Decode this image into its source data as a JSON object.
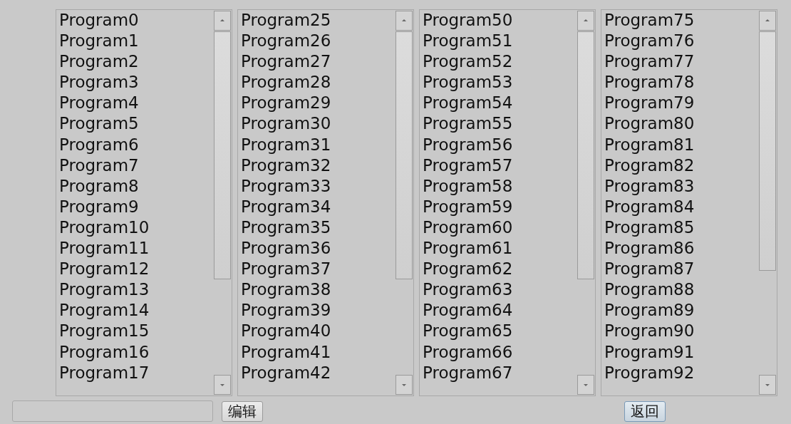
{
  "lists": [
    {
      "items": [
        "Program0",
        "Program1",
        "Program2",
        "Program3",
        "Program4",
        "Program5",
        "Program6",
        "Program7",
        "Program8",
        "Program9",
        "Program10",
        "Program11",
        "Program12",
        "Program13",
        "Program14",
        "Program15",
        "Program16",
        "Program17"
      ]
    },
    {
      "items": [
        "Program25",
        "Program26",
        "Program27",
        "Program28",
        "Program29",
        "Program30",
        "Program31",
        "Program32",
        "Program33",
        "Program34",
        "Program35",
        "Program36",
        "Program37",
        "Program38",
        "Program39",
        "Program40",
        "Program41",
        "Program42"
      ]
    },
    {
      "items": [
        "Program50",
        "Program51",
        "Program52",
        "Program53",
        "Program54",
        "Program55",
        "Program56",
        "Program57",
        "Program58",
        "Program59",
        "Program60",
        "Program61",
        "Program62",
        "Program63",
        "Program64",
        "Program65",
        "Program66",
        "Program67"
      ]
    },
    {
      "items": [
        "Program75",
        "Program76",
        "Program77",
        "Program78",
        "Program79",
        "Program80",
        "Program81",
        "Program82",
        "Program83",
        "Program84",
        "Program85",
        "Program86",
        "Program87",
        "Program88",
        "Program89",
        "Program90",
        "Program91",
        "Program92"
      ]
    }
  ],
  "buttons": [
    {
      "label": "编辑",
      "focused": false
    },
    {
      "label": "返回",
      "focused": true
    }
  ]
}
